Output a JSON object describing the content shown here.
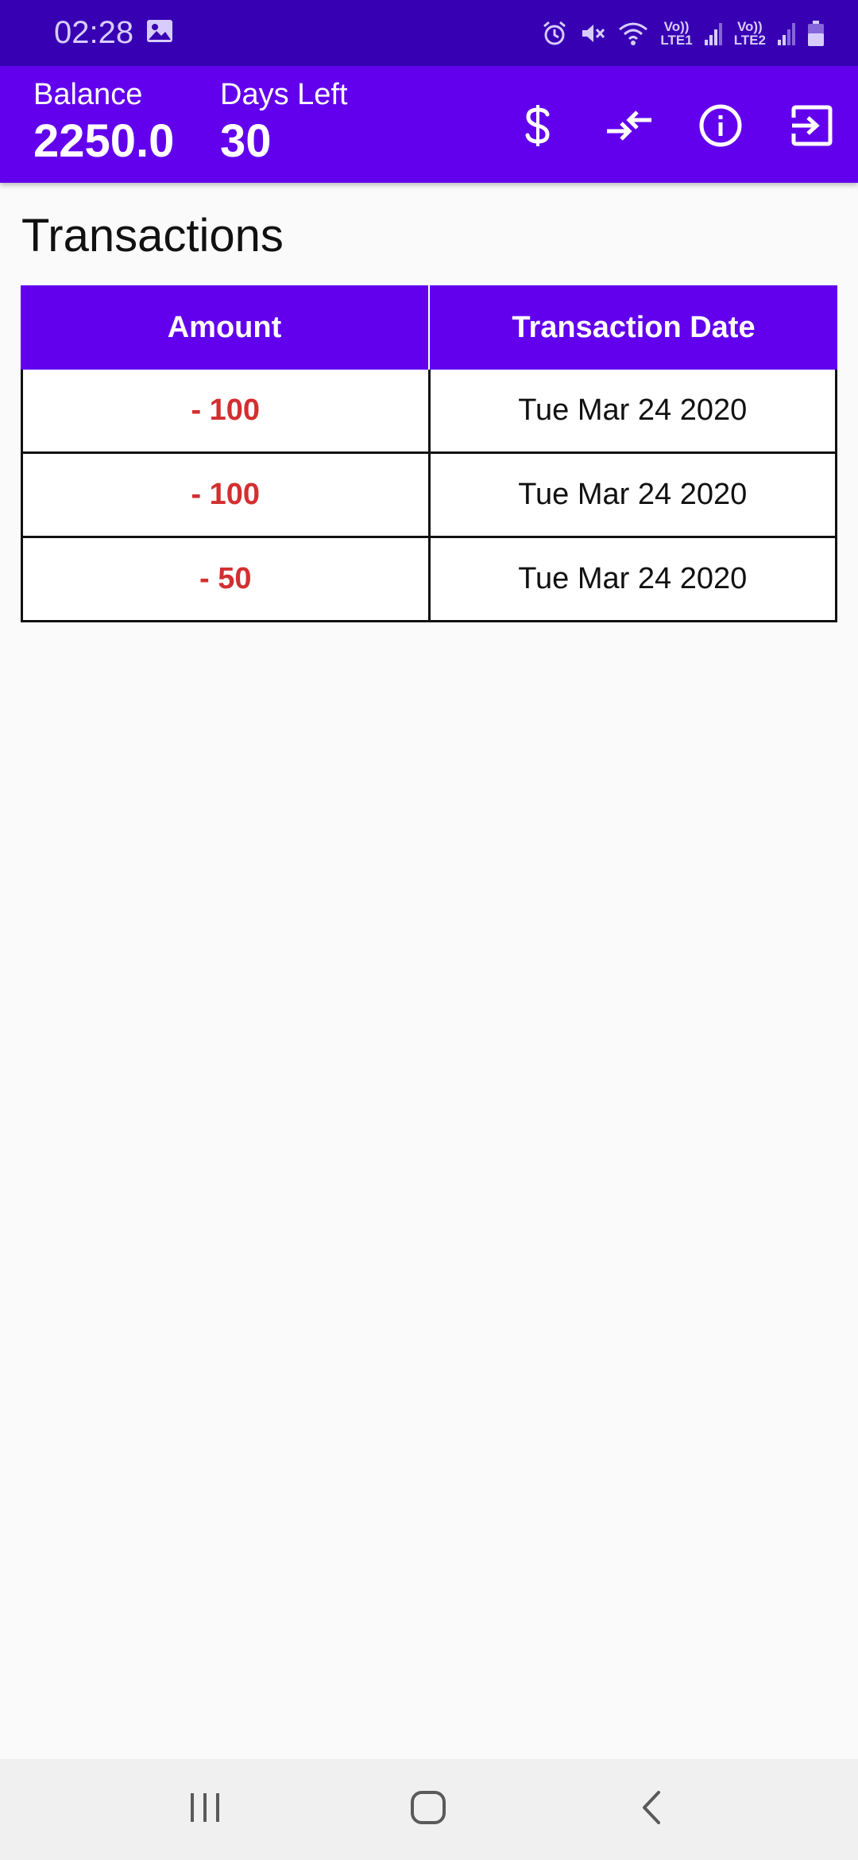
{
  "status_bar": {
    "time": "02:28",
    "sim1_label": "Vo))",
    "sim1_tech": "LTE1",
    "sim2_label": "Vo))",
    "sim2_tech": "LTE2",
    "icons": [
      "gallery-icon",
      "alarm-icon",
      "mute-icon",
      "wifi-icon",
      "signal-icon",
      "battery-icon"
    ]
  },
  "header": {
    "balance_label": "Balance",
    "balance_value": "2250.0",
    "days_left_label": "Days Left",
    "days_left_value": "30",
    "actions": [
      "dollar-icon",
      "transfer-icon",
      "info-icon",
      "logout-icon"
    ]
  },
  "main": {
    "title": "Transactions",
    "table": {
      "columns": [
        "Amount",
        "Transaction Date"
      ],
      "rows": [
        {
          "amount": "- 100",
          "date": "Tue Mar 24 2020"
        },
        {
          "amount": "- 100",
          "date": "Tue Mar 24 2020"
        },
        {
          "amount": "- 50",
          "date": "Tue Mar 24 2020"
        }
      ]
    }
  },
  "nav_bar": {
    "buttons": [
      "recents-icon",
      "home-icon",
      "back-icon"
    ]
  },
  "colors": {
    "status_bar": "#3700b3",
    "primary": "#6200ee",
    "debit_amount": "#d32f2f",
    "background": "#fafafa"
  }
}
